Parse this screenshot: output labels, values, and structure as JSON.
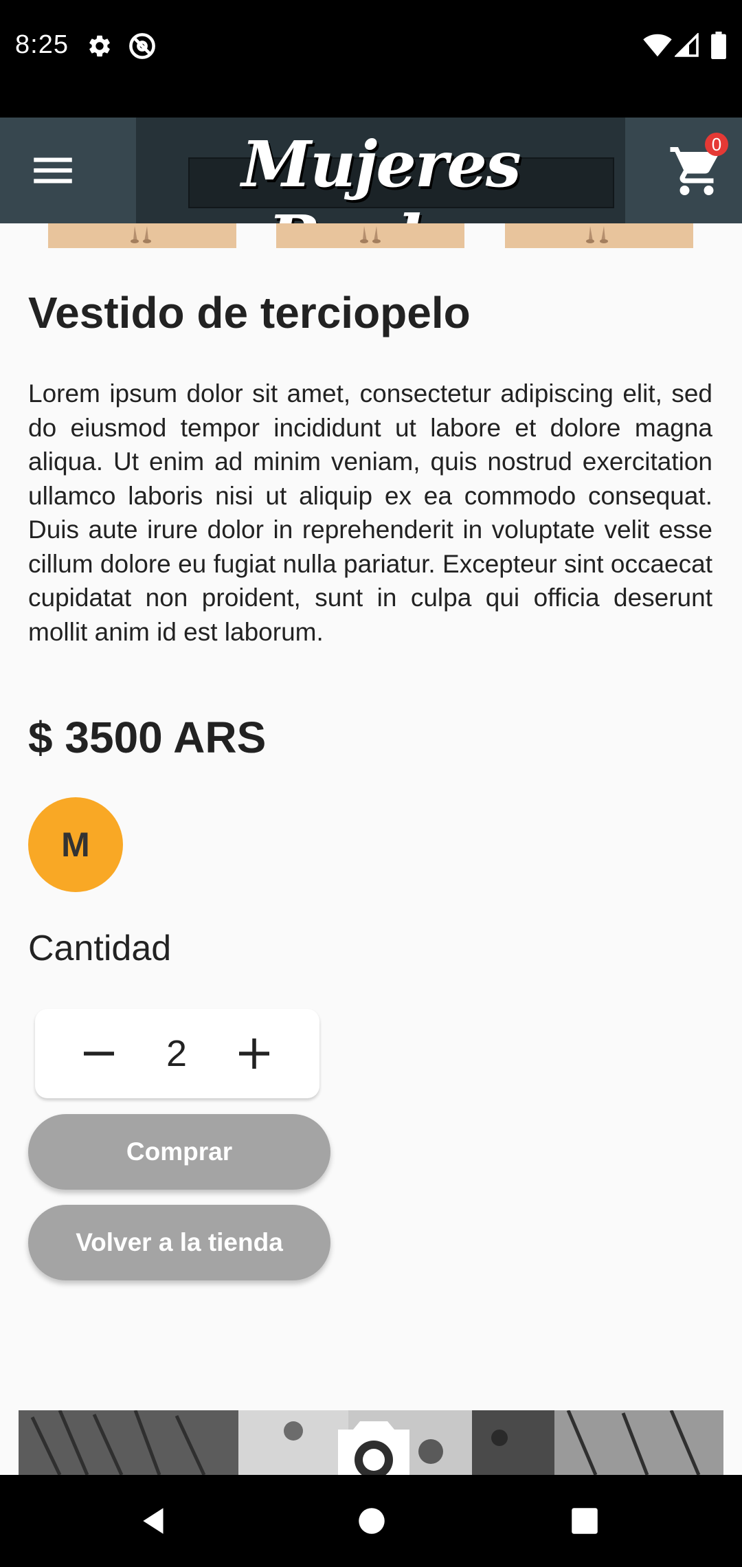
{
  "status_bar": {
    "time": "8:25",
    "icons": [
      "gear-icon",
      "at-sign-icon",
      "wifi-icon",
      "cell-signal-icon",
      "battery-icon"
    ]
  },
  "app_bar": {
    "logo_text": "Mujeres Reales",
    "menu_icon": "hamburger-menu-icon",
    "cart_icon": "shopping-cart-icon",
    "cart_count": "0"
  },
  "product": {
    "title": "Vestido de terciopelo",
    "description": "Lorem ipsum dolor sit amet, consectetur adipiscing elit, sed do eiusmod tempor incididunt ut labore et dolore magna aliqua. Ut enim ad minim veniam, quis nostrud exercitation ullamco laboris nisi ut aliquip ex ea commodo consequat. Duis aute irure dolor in reprehenderit in voluptate velit esse cillum dolore eu fugiat nulla pariatur. Excepteur sint occaecat cupidatat non proident, sunt in culpa qui officia deserunt mollit anim id est laborum.",
    "price": "$ 3500 ARS",
    "size": "M"
  },
  "quantity": {
    "label": "Cantidad",
    "value": "2",
    "minus_symbol": "−",
    "plus_symbol": "+"
  },
  "buttons": {
    "buy": "Comprar",
    "back_to_store": "Volver a la tienda"
  },
  "colors": {
    "app_bar": "#37474f",
    "size_chip": "#f9a825",
    "button": "#a4a4a4",
    "badge": "#e53935"
  },
  "nav_bar": {
    "icons": [
      "back-triangle-icon",
      "home-circle-icon",
      "recents-square-icon"
    ]
  }
}
